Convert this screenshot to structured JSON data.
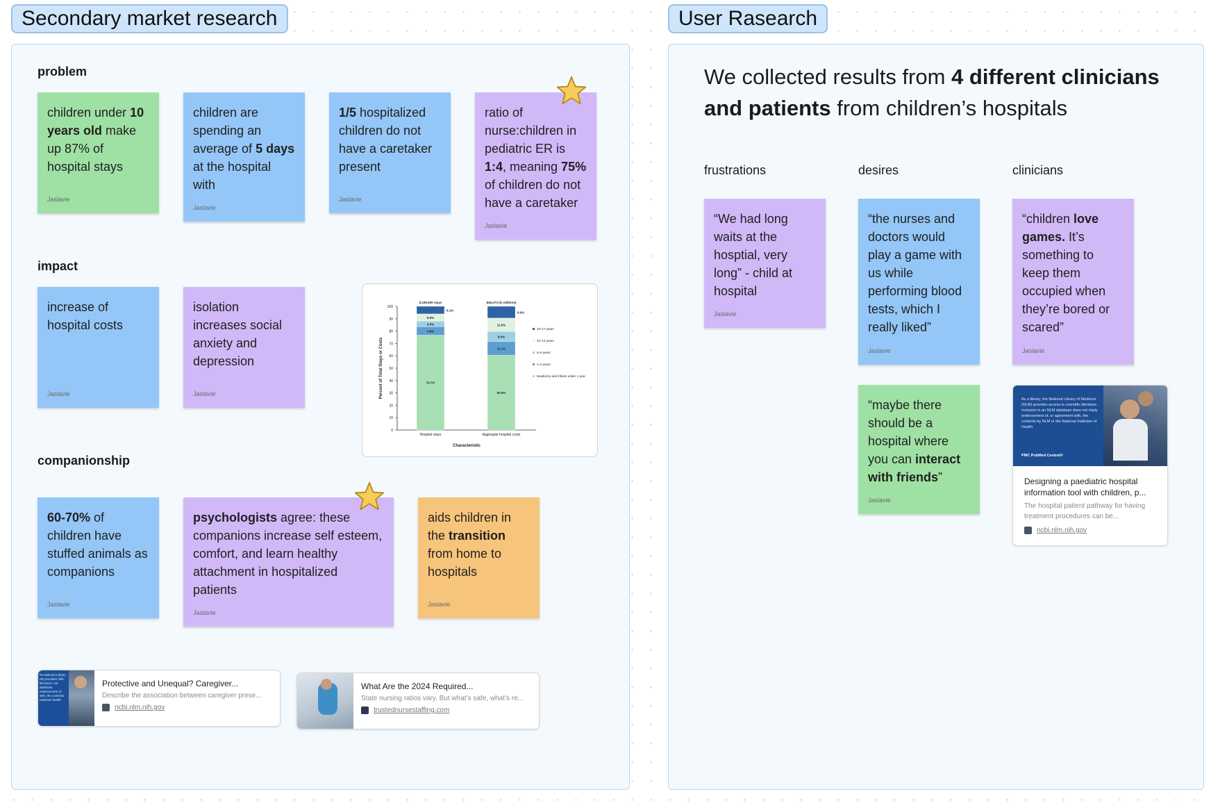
{
  "frames": {
    "left_title": "Secondary market research",
    "right_title": "User Rasearch"
  },
  "sections": {
    "problem": "problem",
    "impact": "impact",
    "companionship": "companionship"
  },
  "stickies": {
    "s1": {
      "t1": "children under ",
      "b1": "10 years old",
      "t2": " make up 87% of hospital stays",
      "author": "Jaslavie"
    },
    "s2": {
      "t1": "children are spending an average of ",
      "b1": "5 days",
      "t2": " at the hospital with",
      "author": "Jaslavie"
    },
    "s3": {
      "b1": "1/5",
      "t1": " hospitalized children do not have a caretaker present",
      "author": "Jaslavie"
    },
    "s4": {
      "t1": "ratio of nurse:children in pediatric ER is ",
      "b1": "1:4",
      "t2": ", meaning ",
      "b2": "75%",
      "t3": " of children do not have a caretaker",
      "author": "Jaslavie"
    },
    "s5": {
      "t1": "increase of hospital costs",
      "author": "Jaslavie"
    },
    "s6": {
      "t1": "isolation increases social anxiety and depression",
      "author": "Jaslavie"
    },
    "s7": {
      "b1": "60-70%",
      "t1": " of children have stuffed animals as companions",
      "author": "Jaslavie"
    },
    "s8": {
      "b1": "psychologists",
      "t1": " agree: these companions increase self esteem, comfort, and learn healthy attachment in hospitalized patients",
      "author": "Jaslavie"
    },
    "s9": {
      "t1": "aids children in the ",
      "b1": "transition",
      "t2": " from home to hospitals",
      "author": "Jaslavie"
    },
    "u1": {
      "t1": "“We had long waits at the hosptial, very long” - child at hospital",
      "author": "Jaslavie"
    },
    "u2": {
      "t1": "“the nurses and doctors would play a game with us while performing blood tests, which I really liked”",
      "author": "Jaslavie"
    },
    "u3": {
      "t1": "“maybe there should be a hospital where you can ",
      "b1": "interact with friends",
      "t2": "”",
      "author": "Jaslavie"
    },
    "u4": {
      "t1": "“children ",
      "b1": "love games.",
      "t2": " It’s something to keep them occupied when they’re bored or scared”",
      "author": "Jaslavie"
    }
  },
  "user_research": {
    "heading_t1": "We collected results from ",
    "heading_b1": "4 different clinicians and patients",
    "heading_t2": " from children’s hospitals",
    "col_frustrations": "frustrations",
    "col_desires": "desires",
    "col_clinicians": "clinicians"
  },
  "chart_data": {
    "type": "bar",
    "stacked": true,
    "categories": [
      "Hospital stays",
      "Aggregate hospital costs"
    ],
    "category_headers": [
      "5,190,500 stays",
      "$46,373 (in millions)"
    ],
    "xlabel": "Characteristic",
    "ylabel": "Percent of Total Stays or Costs",
    "ylim": [
      0,
      100
    ],
    "yticks": [
      "0",
      "10",
      "20",
      "30",
      "40",
      "50",
      "60",
      "70",
      "80",
      "90",
      "100"
    ],
    "legend_position": "right",
    "series": [
      {
        "name": "Newborns and infants under 1 year",
        "color": "#a8dfb4",
        "values": [
          76.7,
          60.5
        ],
        "labels": [
          "76.7%",
          "60.5%"
        ]
      },
      {
        "name": "1–4 years",
        "color": "#5d9fd1",
        "values": [
          6.8,
          11.1
        ],
        "labels": [
          "6.8%",
          "11.1%"
        ]
      },
      {
        "name": "5–9 years",
        "color": "#9fcfe0",
        "values": [
          4.5,
          8.0
        ],
        "labels": [
          "4.5%",
          "8.0%"
        ]
      },
      {
        "name": "10–14 years",
        "color": "#dff2e2",
        "values": [
          5.9,
          11.0
        ],
        "labels": [
          "5.9%",
          "11.0%"
        ]
      },
      {
        "name": "15–17 years",
        "color": "#2e63a4",
        "values": [
          6.1,
          9.4
        ],
        "labels": [
          "6.1%",
          "9.0%"
        ]
      }
    ]
  },
  "links": {
    "l1": {
      "title": "Protective and Unequal? Caregiver...",
      "desc": "Describe the association between caregiver prese...",
      "domain": "ncbi.nlm.nih.gov",
      "thumb_text": "he National Library rM) provides ntific literature. LM database endorsement of with, the contents National Health."
    },
    "l2": {
      "title": "What Are the 2024 Required...",
      "desc": "State nursing ratios vary. But what’s safe, what’s re...",
      "domain": "trustednursestaffing.com"
    },
    "l3": {
      "title": "Designing a paediatric hospital information tool with children, p...",
      "desc": "The hospital patient pathway for having treatment procedures can be...",
      "domain": "ncbi.nlm.nih.gov",
      "thumb_text": "As a library, the National Library of Medicine (NLM) provides access to scientific literature. Inclusion in an NLM database does not imply endorsement of, or agreement with, the contents by NLM or the National Institutes of Health.",
      "thumb_logo": "PMC PubMed Central®"
    }
  },
  "colors": {
    "green": "#9fe1a4",
    "blue": "#94c7f8",
    "purple": "#d1b9f7",
    "orange": "#f6c57b",
    "frame_tag": "#cfe5fb",
    "frame_bg": "#f4f9fe"
  }
}
